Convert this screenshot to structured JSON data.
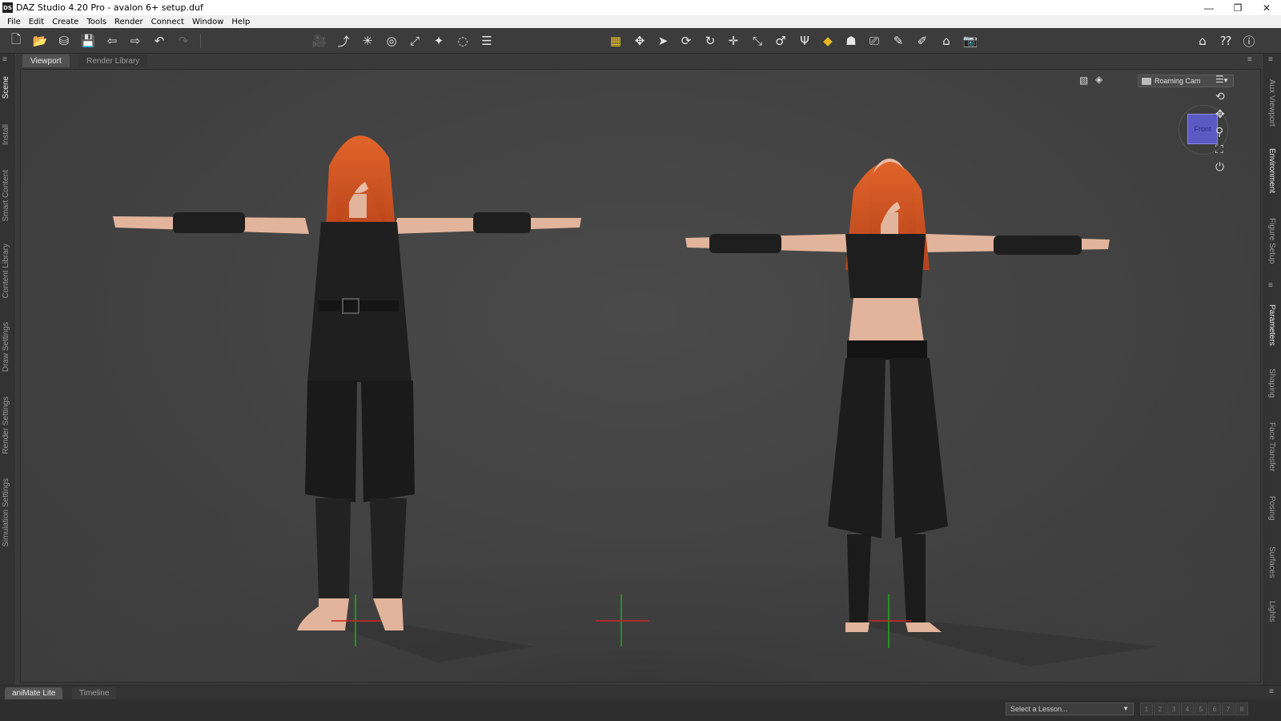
{
  "window": {
    "title": "DAZ Studio 4.20 Pro - avalon 6+ setup.duf",
    "logo_text": "DS",
    "minimize": "—",
    "restore": "❐",
    "close": "✕"
  },
  "menu": [
    "File",
    "Edit",
    "Create",
    "Tools",
    "Render",
    "Connect",
    "Window",
    "Help"
  ],
  "left_panes": [
    "Scene",
    "Install",
    "Smart Content",
    "Content Library",
    "Draw Settings",
    "Render Settings",
    "Simulation Settings"
  ],
  "right_panes": [
    "Aux Viewport",
    "Environment",
    "Figure Setup",
    "Parameters",
    "Shaping",
    "Face Transfer",
    "Posing",
    "Surfaces",
    "Lights"
  ],
  "doc_tabs": [
    {
      "label": "Viewport",
      "active": true
    },
    {
      "label": "Render Library",
      "active": false
    }
  ],
  "viewport": {
    "camera": "Roaming Cam",
    "cube_face": "Front",
    "accent_color": "#5a5ac2"
  },
  "bottom_tabs": [
    {
      "label": "aniMate Lite",
      "active": true
    },
    {
      "label": "Timeline",
      "active": false
    }
  ],
  "status": {
    "lesson_placeholder": "Select a Lesson...",
    "steps": [
      "1",
      "2",
      "3",
      "4",
      "5",
      "6",
      "7",
      "8"
    ]
  },
  "colors": {
    "hair": "#d2521e",
    "outfit": "#1c1c1c",
    "skin": "#e6b8a2",
    "axis_x": "#d02020",
    "axis_y": "#18b018"
  }
}
